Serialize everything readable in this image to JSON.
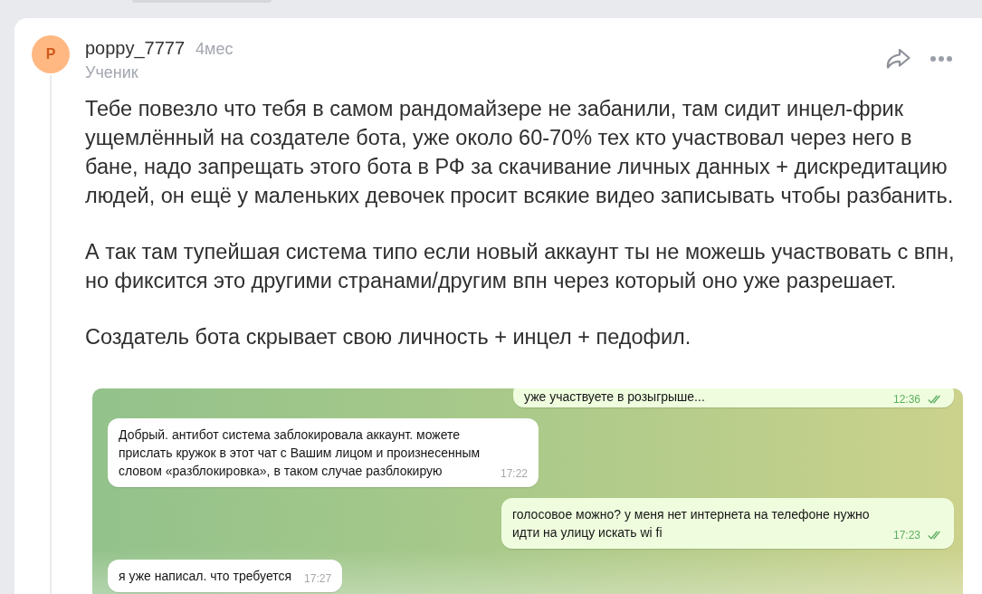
{
  "comment": {
    "avatar": {
      "initial": "P"
    },
    "author": "poppy_7777",
    "posted": "4мес",
    "rank": "Ученик",
    "paragraphs": [
      "Тебе повезло что тебя в самом рандомайзере не забанили, там сидит инцел-фрик ущемлённый на создателе бота, уже около 60-70% тех кто участвовал через него в бане, надо запрещать этого бота в РФ за скачивание личных данных + дискредитацию людей, он ещё у маленьких девочек просит всякие видео записывать чтобы разбанить.",
      "А так там тупейшая система типо если новый аккаунт ты не можешь участвовать с впн, но фиксится это другими странами/другим впн через который оно уже разрешает.",
      "Создатель бота скрывает свою личность + инцел + педофил."
    ],
    "attachment": {
      "messages": [
        {
          "kind": "outgoing",
          "text": "уже участвуете в розыгрыше...",
          "time": "12:36",
          "read": true
        },
        {
          "kind": "incoming",
          "text": "Добрый. антибот система заблокировала аккаунт. можете прислать кружок в этот чат с Вашим лицом и произнесенным словом «разблокировка», в таком случае разблокирую",
          "time": "17:22",
          "read": false
        },
        {
          "kind": "outgoing",
          "text": "голосовое можно? у меня нет интернета на телефоне нужно идти на улицу искать wi fi",
          "time": "17:23",
          "read": true
        },
        {
          "kind": "incoming",
          "text": "я уже написал. что требуется",
          "time": "17:27",
          "read": false
        }
      ]
    }
  }
}
